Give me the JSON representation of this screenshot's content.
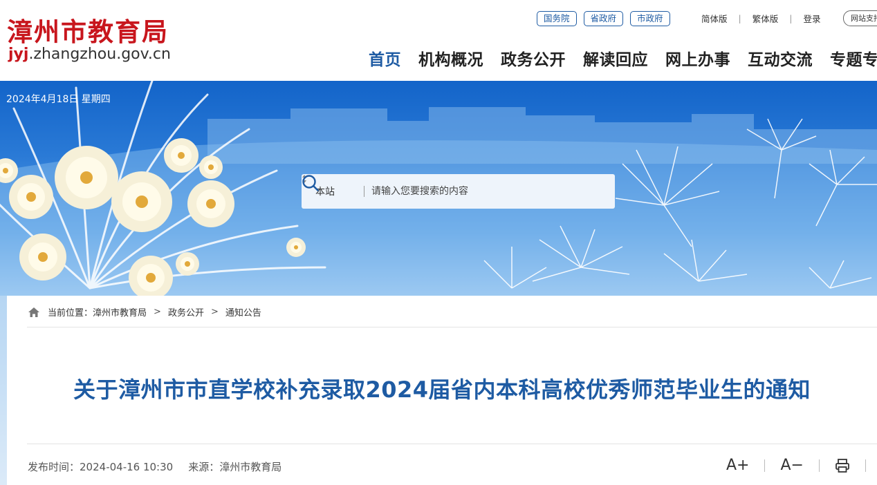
{
  "header": {
    "logo_cn": "漳州市教育局",
    "logo_url_highlight": "jyj",
    "logo_url_rest": ".zhangzhou.gov.cn",
    "gov_links": [
      "国务院",
      "省政府",
      "市政府"
    ],
    "util_links": [
      "简体版",
      "繁体版",
      "登录"
    ],
    "a11y_label": "网站支持"
  },
  "nav": {
    "items": [
      "首页",
      "机构概况",
      "政务公开",
      "解读回应",
      "网上办事",
      "互动交流",
      "专题专栏"
    ],
    "active_index": 0,
    "active_color": "#1e5ba3"
  },
  "banner": {
    "date": "2024年4月18日 星期四",
    "search": {
      "scope": "本站",
      "placeholder": "请输入您要搜索的内容"
    }
  },
  "breadcrumb": {
    "prefix": "当前位置：",
    "items": [
      "漳州市教育局",
      "政务公开",
      "通知公告"
    ],
    "separator": ">"
  },
  "article": {
    "title": "关于漳州市市直学校补充录取2024届省内本科高校优秀师范毕业生的通知",
    "publish_label": "发布时间：",
    "publish_time": "2024-04-16 10:30",
    "source_label": "来源：",
    "source": "漳州市教育局"
  },
  "tools": {
    "font_increase": "A+",
    "font_decrease": "A−"
  },
  "colors": {
    "brand_red": "#c8161d",
    "brand_blue": "#1e5ba3"
  },
  "icons": [
    "home-icon",
    "search-icon",
    "sort-arrows-icon",
    "print-icon",
    "share-icon"
  ]
}
